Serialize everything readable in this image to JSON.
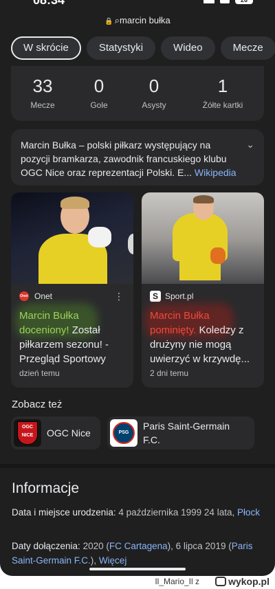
{
  "status_bar": {
    "time": "08:34",
    "battery": "26"
  },
  "address_bar": {
    "query": "marcin bułka"
  },
  "tabs": [
    {
      "label": "W skrócie",
      "active": true
    },
    {
      "label": "Statystyki"
    },
    {
      "label": "Wideo"
    },
    {
      "label": "Mecze"
    }
  ],
  "stats": [
    {
      "value": "33",
      "label": "Mecze"
    },
    {
      "value": "0",
      "label": "Gole"
    },
    {
      "value": "0",
      "label": "Asysty"
    },
    {
      "value": "1",
      "label": "Żółte kartki"
    }
  ],
  "description": {
    "text": "Marcin Bułka – polski piłkarz występujący na pozycji bramkarza, zawodnik francuskiego klubu OGC Nice oraz reprezentacji Polski. E...",
    "source_link": "Wikipedia"
  },
  "news": [
    {
      "source": "Onet",
      "headline_highlight": "Marcin Bułka doceniony!",
      "headline_rest": "Został piłkarzem sezonu! - Przegląd Sportowy",
      "time": "dzień temu"
    },
    {
      "source": "Sport.pl",
      "headline_highlight": "Marcin Bułka pominięty.",
      "headline_rest": "Koledzy z drużyny nie mogą uwierzyć w krzywdę...",
      "time": "2 dni temu"
    }
  ],
  "see_also": {
    "title": "Zobacz też",
    "items": [
      {
        "name": "OGC Nice",
        "logo_text": "OGC NICE"
      },
      {
        "name": "Paris Saint-Germain F.C.",
        "logo_text": "PSG"
      }
    ]
  },
  "info": {
    "title": "Informacje",
    "birth_label": "Data i miejsce urodzenia:",
    "birth_value": "4 października 1999 24 lata,",
    "birth_place": "Płock",
    "joined_label": "Daty dołączenia:",
    "joined_year": "2020 (",
    "joined_club1": "FC Cartagena",
    "joined_mid": "), 6 lipca 2019 (",
    "joined_club2": "Paris Saint-Germain F.C.",
    "joined_end": "),",
    "more_link": "Więcej"
  },
  "watermark": {
    "user": "Il_Mario_Il z",
    "site": "wykop.pl"
  },
  "colors": {
    "background": "#1f1f1f",
    "card": "#2a2a2c",
    "link": "#8ab4f8",
    "highlight_green": "#9cd15b",
    "highlight_red": "#f04a3a"
  }
}
